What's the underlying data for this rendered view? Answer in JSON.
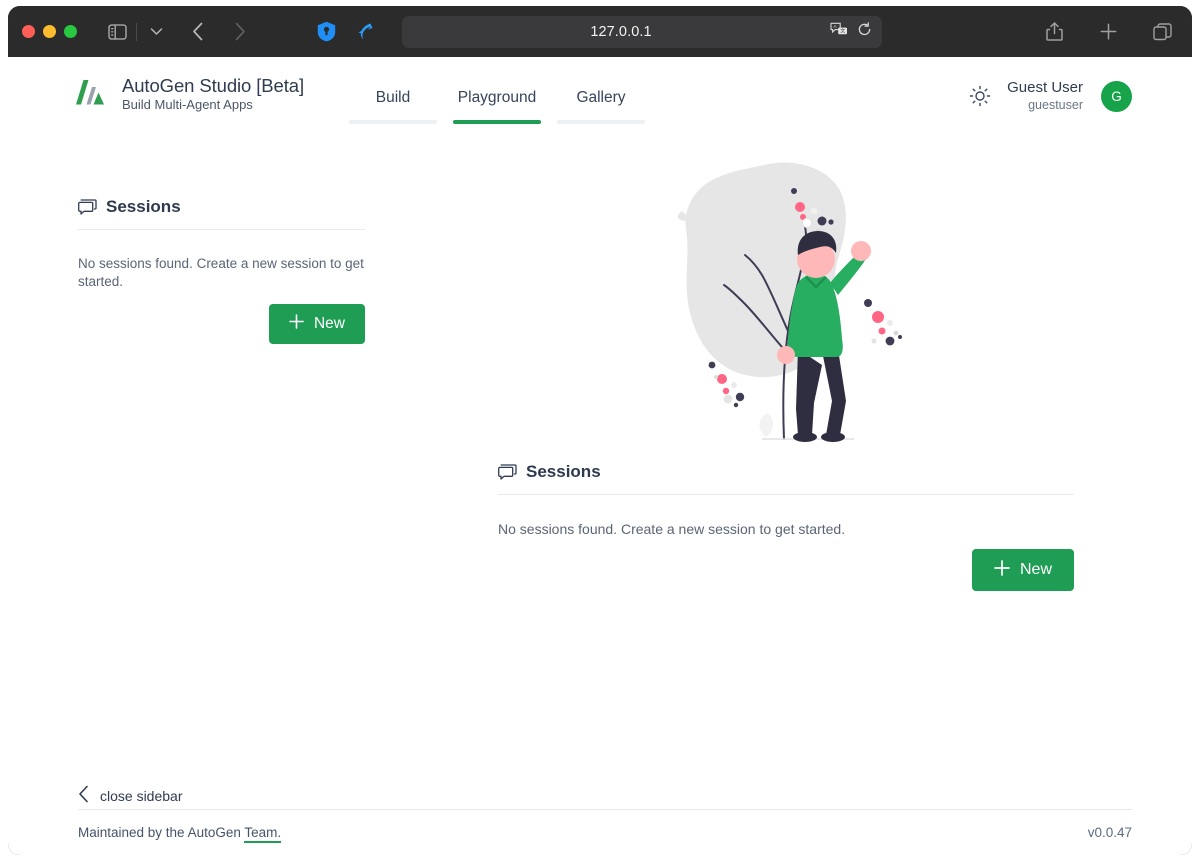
{
  "browser": {
    "url": "127.0.0.1",
    "controls": {
      "close": "close-window",
      "minimize": "minimize-window",
      "maximize": "maximize-window",
      "sidebar_toggle": "sidebar-toggle-icon",
      "tab_group_chevron": "chevron-down-icon",
      "back": "back-arrow-icon",
      "forward": "forward-arrow-icon",
      "extension_1password": "1password-icon",
      "extension_bird": "bird-extension-icon",
      "translate": "translate-icon",
      "reload": "reload-icon",
      "share": "share-icon",
      "new_tab": "plus-icon",
      "tab_overview": "tabs-overview-icon"
    }
  },
  "app": {
    "brand": {
      "title": "AutoGen Studio [Beta]",
      "subtitle": "Build Multi-Agent Apps",
      "logo_icon": "autogen-logo"
    },
    "tabs": [
      {
        "label": "Build",
        "active": false
      },
      {
        "label": "Playground",
        "active": true
      },
      {
        "label": "Gallery",
        "active": false
      }
    ],
    "header_right": {
      "theme_icon": "sun-icon",
      "user_name": "Guest User",
      "user_handle": "guestuser",
      "avatar_initial": "G"
    }
  },
  "sidebar": {
    "panel_icon": "chat-bubble-icon",
    "title": "Sessions",
    "empty_message": "No sessions found. Create a new session to get started.",
    "new_button": {
      "label": "New",
      "icon": "plus-icon"
    }
  },
  "main": {
    "illustration": "person-with-sparkler-illustration",
    "panel_icon": "chat-bubble-icon",
    "title": "Sessions",
    "empty_message": "No sessions found. Create a new session to get started.",
    "new_button": {
      "label": "New",
      "icon": "plus-icon"
    }
  },
  "close_sidebar": {
    "label": "close sidebar",
    "icon": "chevron-left-icon"
  },
  "footer": {
    "maintained_prefix": "Maintained by the AutoGen ",
    "maintained_link": "Team.",
    "version": "v0.0.47"
  },
  "colors": {
    "accent_green": "#1f9d55",
    "avatar_green": "#16a34a",
    "text_dark": "#2f3c50",
    "text_muted": "#5a6575",
    "chrome_bg": "#2b2b2b",
    "address_bg": "#3a3a3c"
  }
}
